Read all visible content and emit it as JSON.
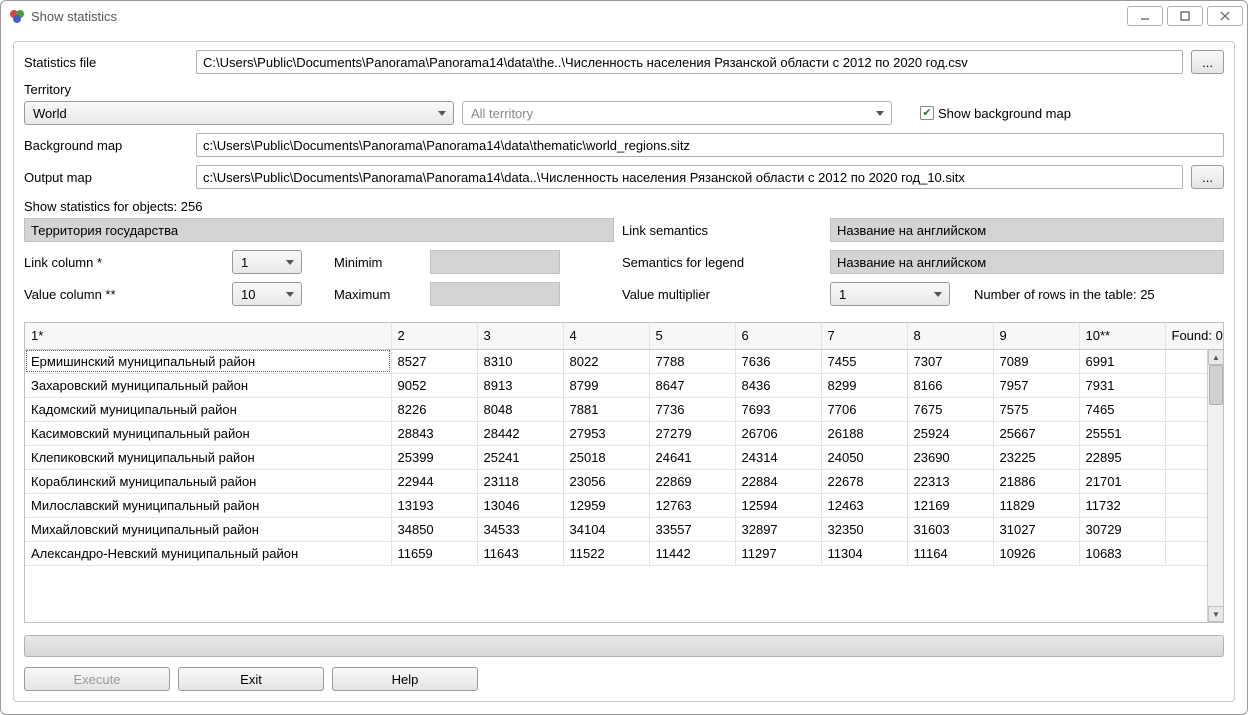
{
  "window": {
    "title": "Show statistics"
  },
  "labels": {
    "stats_file": "Statistics file",
    "territory": "Territory",
    "bg_map": "Background map",
    "output_map": "Output map",
    "show_stats": "Show statistics for objects: 256",
    "territory_header": "Территория государства",
    "link_semantics": "Link semantics",
    "link_column": "Link column *",
    "minimum": "Minimim",
    "semantics_legend": "Semantics for legend",
    "value_column": "Value column **",
    "maximum": "Maximum",
    "value_multiplier": "Value multiplier",
    "num_rows": "Number of rows in the table: 25",
    "show_bg": "Show background map"
  },
  "values": {
    "stats_file": "C:\\Users\\Public\\Documents\\Panorama\\Panorama14\\data\\the..\\Численность населения Рязанской области с 2012 по 2020 год.csv",
    "world": "World",
    "all_territory": "All territory",
    "bg_map": "c:\\Users\\Public\\Documents\\Panorama\\Panorama14\\data\\thematic\\world_regions.sitz",
    "output_map": "c:\\Users\\Public\\Documents\\Panorama\\Panorama14\\data..\\Численность населения Рязанской области с 2012 по 2020 год_10.sitx",
    "link_sem_val": "Название на английском",
    "sem_legend_val": "Название на английском",
    "link_col": "1",
    "value_col": "10",
    "multiplier": "1",
    "found": "Found: 0"
  },
  "buttons": {
    "browse": "...",
    "execute": "Execute",
    "exit": "Exit",
    "help": "Help"
  },
  "table": {
    "headers": [
      "1*",
      "2",
      "3",
      "4",
      "5",
      "6",
      "7",
      "8",
      "9",
      "10**"
    ],
    "rows": [
      {
        "n": "Ермишинский муниципальный район",
        "v": [
          "8527",
          "8310",
          "8022",
          "7788",
          "7636",
          "7455",
          "7307",
          "7089",
          "6991"
        ]
      },
      {
        "n": "Захаровский муниципальный район",
        "v": [
          "9052",
          "8913",
          "8799",
          "8647",
          "8436",
          "8299",
          "8166",
          "7957",
          "7931"
        ]
      },
      {
        "n": "Кадомский муниципальный район",
        "v": [
          "8226",
          "8048",
          "7881",
          "7736",
          "7693",
          "7706",
          "7675",
          "7575",
          "7465"
        ]
      },
      {
        "n": "Касимовский муниципальный район",
        "v": [
          "28843",
          "28442",
          "27953",
          "27279",
          "26706",
          "26188",
          "25924",
          "25667",
          "25551"
        ]
      },
      {
        "n": "Клепиковский муниципальный район",
        "v": [
          "25399",
          "25241",
          "25018",
          "24641",
          "24314",
          "24050",
          "23690",
          "23225",
          "22895"
        ]
      },
      {
        "n": "Кораблинский муниципальный район",
        "v": [
          "22944",
          "23118",
          "23056",
          "22869",
          "22884",
          "22678",
          "22313",
          "21886",
          "21701"
        ]
      },
      {
        "n": "Милославский муниципальный район",
        "v": [
          "13193",
          "13046",
          "12959",
          "12763",
          "12594",
          "12463",
          "12169",
          "11829",
          "11732"
        ]
      },
      {
        "n": "Михайловский муниципальный район",
        "v": [
          "34850",
          "34533",
          "34104",
          "33557",
          "32897",
          "32350",
          "31603",
          "31027",
          "30729"
        ]
      },
      {
        "n": "Александро-Невский муниципальный район",
        "v": [
          "11659",
          "11643",
          "11522",
          "11442",
          "11297",
          "11304",
          "11164",
          "10926",
          "10683"
        ]
      }
    ]
  }
}
